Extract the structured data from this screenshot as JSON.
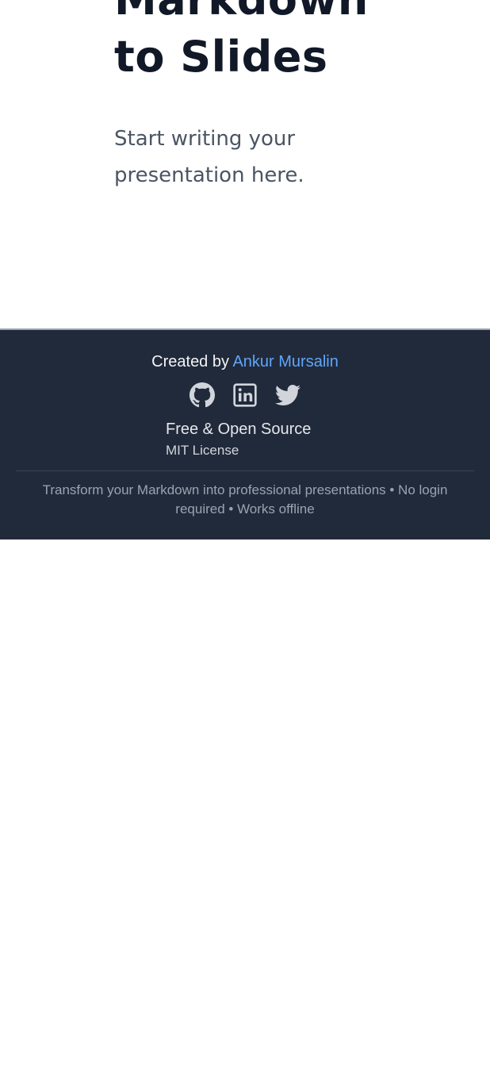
{
  "slide": {
    "title_line1": "Markdown",
    "title_line2": "to Slides",
    "body": "Start writing your presentation here."
  },
  "footer": {
    "created_prefix": "Created by",
    "author_name": "Ankur Mursalin",
    "social_icons": [
      "github-icon",
      "linkedin-icon",
      "twitter-icon"
    ],
    "oss_title": "Free & Open Source",
    "license": "MIT License",
    "tagline": "Transform your Markdown into professional presentations • No login required • Works offline"
  },
  "colors": {
    "footer_bg": "#212a3b",
    "link": "#60a5fa",
    "title": "#111827",
    "body_text": "#4b5563"
  }
}
